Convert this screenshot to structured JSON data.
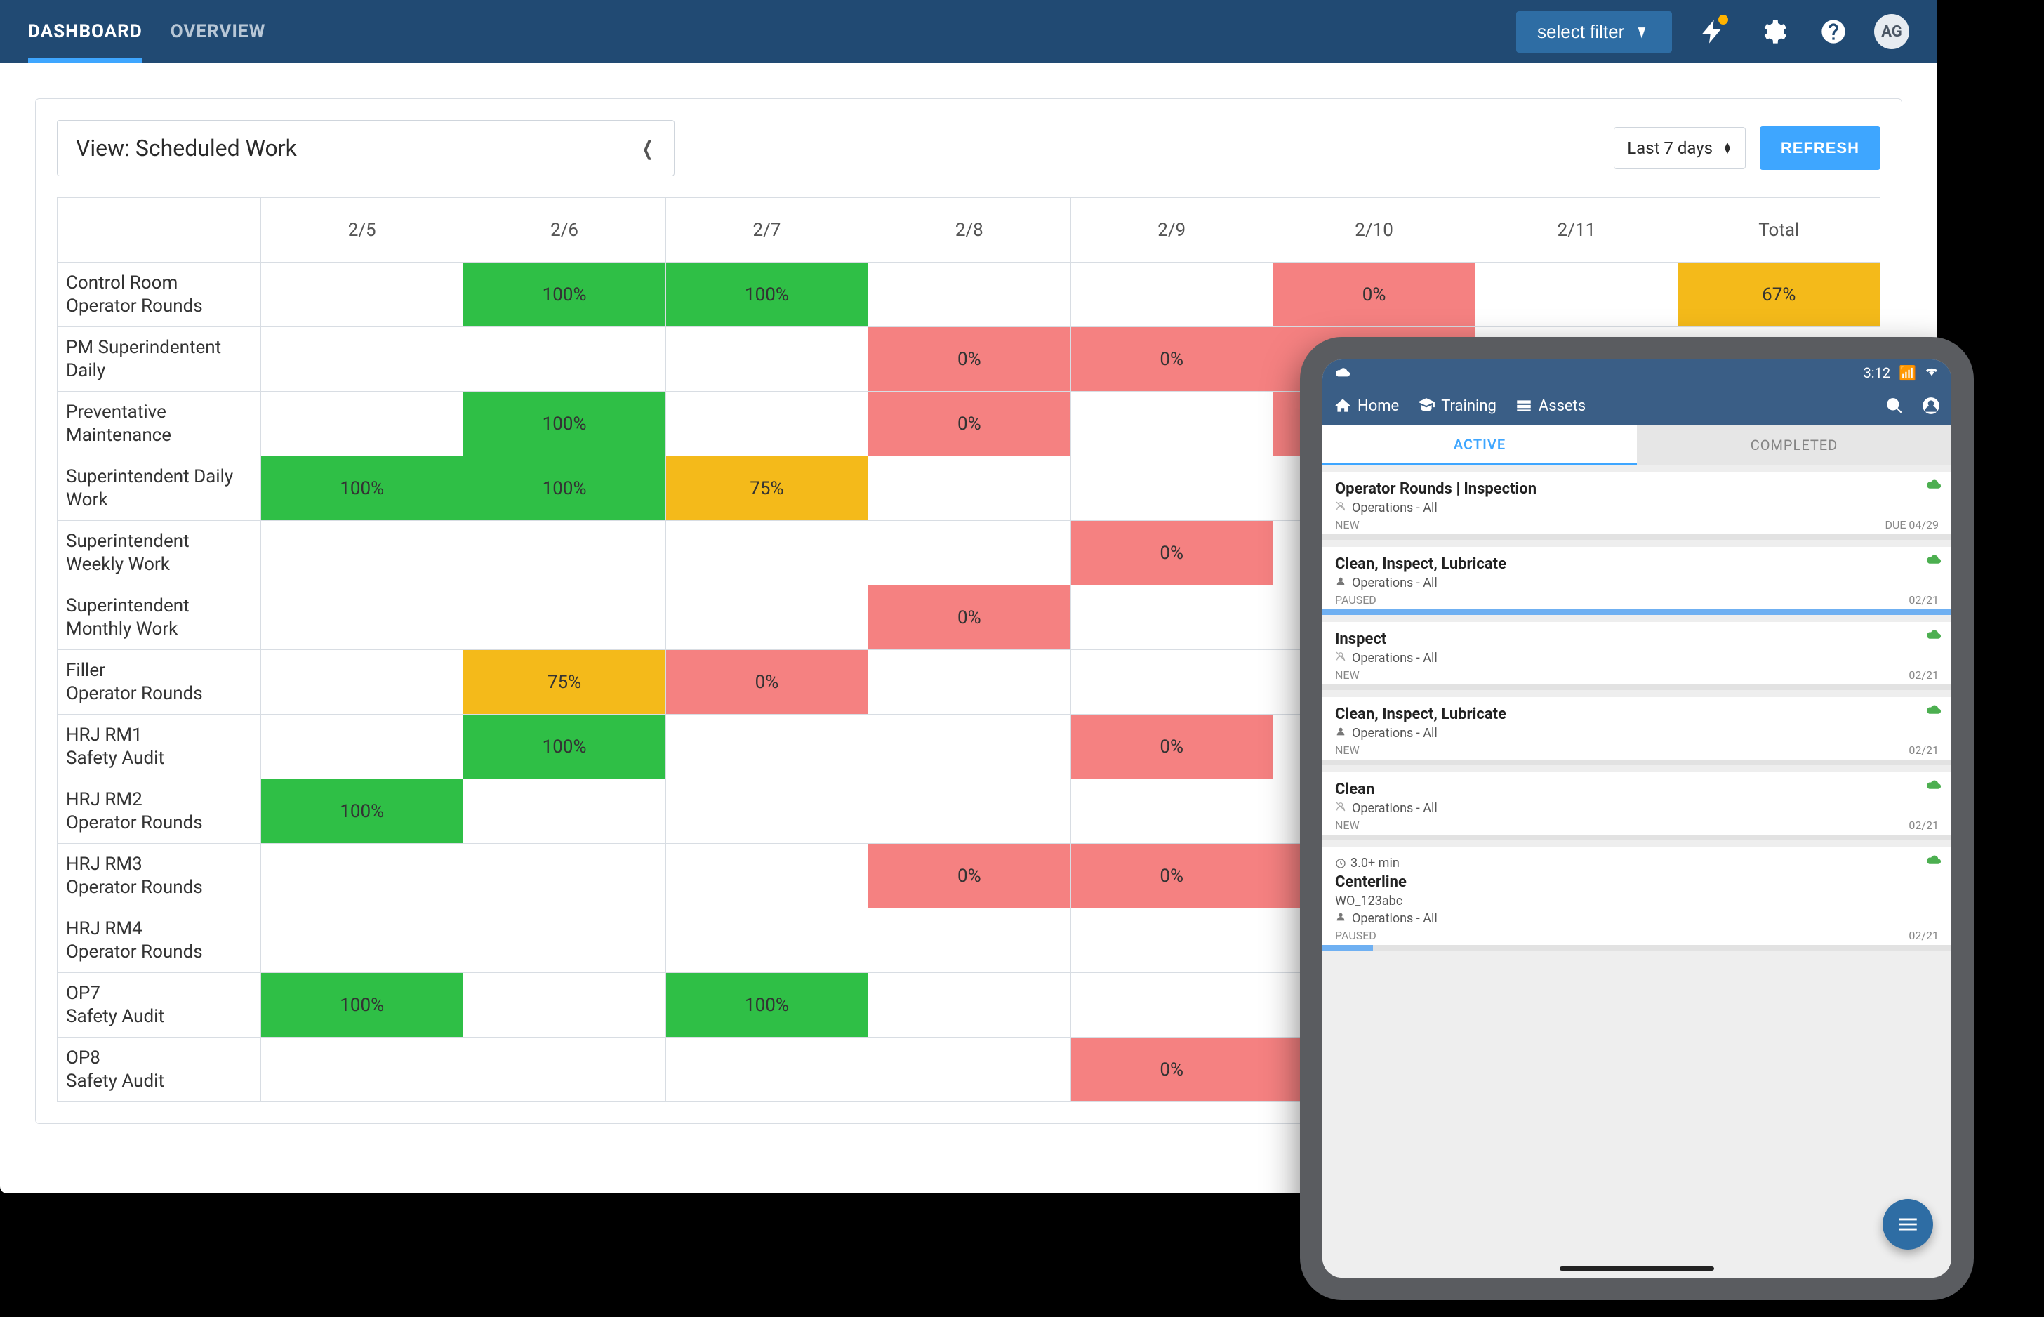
{
  "topnav": {
    "tabs": [
      "DASHBOARD",
      "OVERVIEW"
    ],
    "active_index": 0,
    "filter_label": "select filter",
    "avatar": "AG"
  },
  "card": {
    "view_label": "View: Scheduled Work",
    "range_label": "Last 7 days",
    "refresh_label": "REFRESH"
  },
  "grid": {
    "columns": [
      "2/5",
      "2/6",
      "2/7",
      "2/8",
      "2/9",
      "2/10",
      "2/11",
      "Total"
    ],
    "rows": [
      {
        "label1": "Control Room",
        "label2": "Operator Rounds",
        "cells": [
          "",
          "100%:green",
          "100%:green",
          "",
          "",
          "0%:red",
          "",
          "67%:yellow"
        ]
      },
      {
        "label1": "PM Superindentent",
        "label2": "Daily",
        "cells": [
          "",
          "",
          "",
          "0%:red",
          "0%:red",
          "0%:red",
          "",
          ""
        ]
      },
      {
        "label1": "Preventative",
        "label2": "Maintenance",
        "cells": [
          "",
          "100%:green",
          "",
          "0%:red",
          "",
          "0%:red",
          "",
          ""
        ]
      },
      {
        "label1": "Superintendent Daily",
        "label2": "Work",
        "cells": [
          "100%:green",
          "100%:green",
          "75%:yellow",
          "",
          "",
          "",
          "",
          ""
        ]
      },
      {
        "label1": "Superintendent",
        "label2": "Weekly Work",
        "cells": [
          "",
          "",
          "",
          "",
          "0%:red",
          "",
          "",
          ""
        ]
      },
      {
        "label1": "Superintendent",
        "label2": "Monthly Work",
        "cells": [
          "",
          "",
          "",
          "0%:red",
          "",
          "",
          "",
          ""
        ]
      },
      {
        "label1": "Filler",
        "label2": "Operator Rounds",
        "cells": [
          "",
          "75%:yellow",
          "0%:red",
          "",
          "",
          "",
          "",
          ""
        ]
      },
      {
        "label1": "HRJ RM1",
        "label2": "Safety Audit",
        "cells": [
          "",
          "100%:green",
          "",
          "",
          "0%:red",
          "",
          "",
          ""
        ]
      },
      {
        "label1": "HRJ RM2",
        "label2": "Operator Rounds",
        "cells": [
          "100%:green",
          "",
          "",
          "",
          "",
          "",
          "",
          ""
        ]
      },
      {
        "label1": "HRJ RM3",
        "label2": "Operator Rounds",
        "cells": [
          "",
          "",
          "",
          "0%:red",
          "0%:red",
          "0%:red",
          "",
          ""
        ]
      },
      {
        "label1": "HRJ RM4",
        "label2": "Operator Rounds",
        "cells": [
          "",
          "",
          "",
          "",
          "",
          "",
          "",
          ""
        ]
      },
      {
        "label1": "OP7",
        "label2": "Safety Audit",
        "cells": [
          "100%:green",
          "",
          "100%:green",
          "",
          "",
          "",
          "",
          ""
        ]
      },
      {
        "label1": "OP8",
        "label2": "Safety Audit",
        "cells": [
          "",
          "",
          "",
          "",
          "0%:red",
          "0%:red",
          "",
          ""
        ]
      }
    ]
  },
  "tablet": {
    "status_time": "3:12",
    "nav": {
      "home": "Home",
      "training": "Training",
      "assets": "Assets"
    },
    "seg": {
      "active": "ACTIVE",
      "completed": "COMPLETED"
    },
    "items": [
      {
        "title": "Operator Rounds | Inspection",
        "sub": "Operations - All",
        "sub_icon": "person-off",
        "status": "NEW",
        "right": "DUE 04/29",
        "progress": 0,
        "extra_time": "",
        "extra_line": ""
      },
      {
        "title": "Clean, Inspect, Lubricate",
        "sub": "Operations - All",
        "sub_icon": "person",
        "status": "PAUSED",
        "right": "02/21",
        "progress": 100,
        "extra_time": "",
        "extra_line": ""
      },
      {
        "title": "Inspect",
        "sub": "Operations - All",
        "sub_icon": "person-off",
        "status": "NEW",
        "right": "02/21",
        "progress": 0,
        "extra_time": "",
        "extra_line": ""
      },
      {
        "title": "Clean, Inspect, Lubricate",
        "sub": "Operations - All",
        "sub_icon": "person",
        "status": "NEW",
        "right": "02/21",
        "progress": 0,
        "extra_time": "",
        "extra_line": ""
      },
      {
        "title": "Clean",
        "sub": "Operations - All",
        "sub_icon": "person-off",
        "status": "NEW",
        "right": "02/21",
        "progress": 0,
        "extra_time": "",
        "extra_line": ""
      },
      {
        "title": "Centerline",
        "sub": "Operations - All",
        "sub_icon": "person",
        "status": "PAUSED",
        "right": "02/21",
        "progress": 8,
        "extra_time": "3.0+ min",
        "extra_line": "WO_123abc"
      }
    ]
  }
}
